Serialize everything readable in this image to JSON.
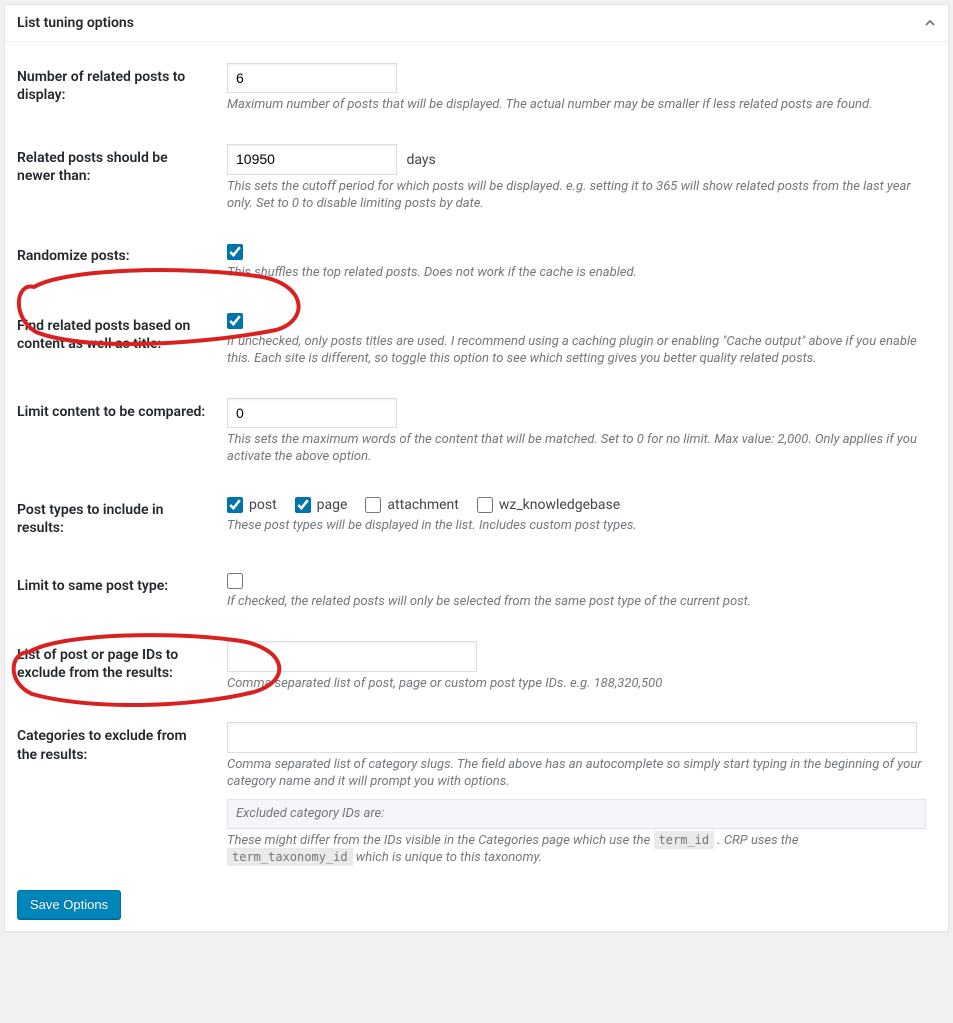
{
  "panel": {
    "title": "List tuning options"
  },
  "fields": {
    "num_posts": {
      "label": "Number of related posts to display:",
      "value": "6",
      "desc": "Maximum number of posts that will be displayed. The actual number may be smaller if less related posts are found."
    },
    "newer_than": {
      "label": "Related posts should be newer than:",
      "value": "10950",
      "unit": "days",
      "desc": "This sets the cutoff period for which posts will be displayed. e.g. setting it to 365 will show related posts from the last year only. Set to 0 to disable limiting posts by date."
    },
    "randomize": {
      "label": "Randomize posts:",
      "checked": true,
      "desc": "This shuffles the top related posts. Does not work if the cache is enabled."
    },
    "content_title": {
      "label": "Find related posts based on content as well as title:",
      "checked": true,
      "desc": "If unchecked, only posts titles are used. I recommend using a caching plugin or enabling \"Cache output\" above if you enable this. Each site is different, so toggle this option to see which setting gives you better quality related posts."
    },
    "limit_content": {
      "label": "Limit content to be compared:",
      "value": "0",
      "desc": "This sets the maximum words of the content that will be matched. Set to 0 for no limit. Max value: 2,000. Only applies if you activate the above option."
    },
    "post_types": {
      "label": "Post types to include in results:",
      "options": [
        {
          "label": "post",
          "checked": true
        },
        {
          "label": "page",
          "checked": true
        },
        {
          "label": "attachment",
          "checked": false
        },
        {
          "label": "wz_knowledgebase",
          "checked": false
        }
      ],
      "desc": "These post types will be displayed in the list. Includes custom post types."
    },
    "same_post_type": {
      "label": "Limit to same post type:",
      "checked": false,
      "desc": "If checked, the related posts will only be selected from the same post type of the current post."
    },
    "exclude_ids": {
      "label": "List of post or page IDs to exclude from the results:",
      "value": "",
      "desc": "Comma separated list of post, page or custom post type IDs. e.g. 188,320,500"
    },
    "exclude_cats": {
      "label": "Categories to exclude from the results:",
      "value": "",
      "desc": "Comma separated list of category slugs. The field above has an autocomplete so simply start typing in the beginning of your category name and it will prompt you with options.",
      "excluded_ids_label": "Excluded category IDs are:",
      "excluded_ids_desc_prefix": "These might differ from the IDs visible in the Categories page which use the ",
      "excluded_ids_desc_mid": " . CRP uses the ",
      "excluded_ids_desc_suffix": " which is unique to this taxonomy.",
      "code1": "term_id",
      "code2": "term_taxonomy_id"
    }
  },
  "buttons": {
    "save": "Save Options"
  }
}
